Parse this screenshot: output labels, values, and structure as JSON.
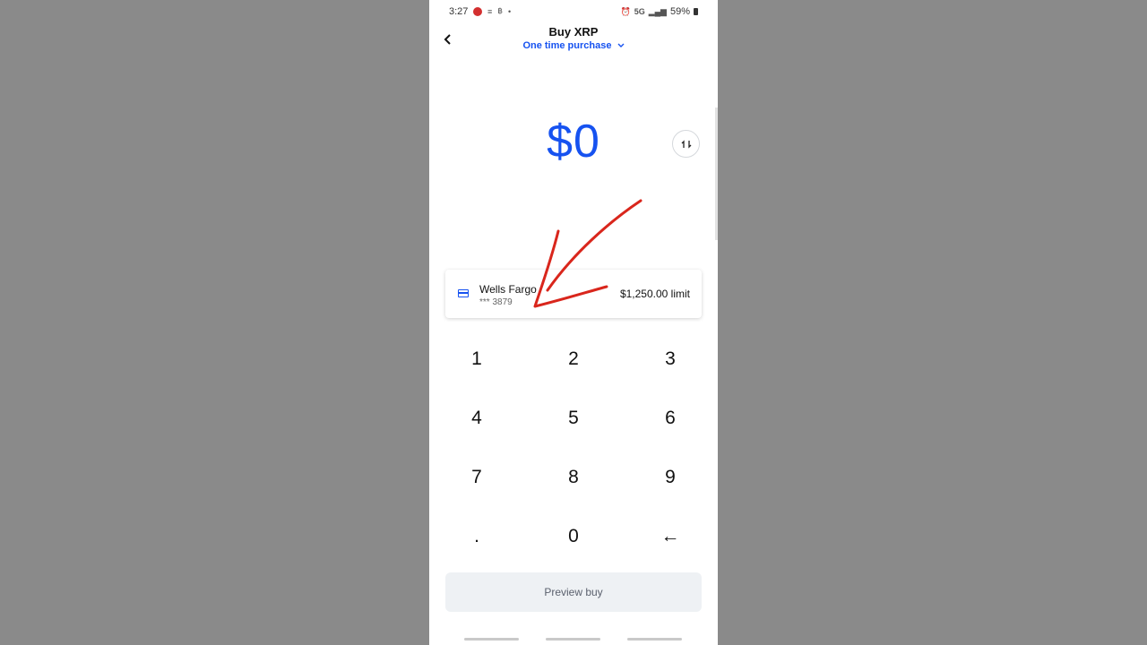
{
  "status_bar": {
    "time": "3:27",
    "network": "5G",
    "battery": "59%"
  },
  "header": {
    "title": "Buy XRP",
    "purchase_type": "One time purchase"
  },
  "amount": {
    "value": "$0"
  },
  "payment_method": {
    "bank_name": "Wells Fargo",
    "account_mask": "*** 3879",
    "limit": "$1,250.00 limit"
  },
  "keypad": {
    "keys": [
      "1",
      "2",
      "3",
      "4",
      "5",
      "6",
      "7",
      "8",
      "9",
      ".",
      "0",
      "←"
    ]
  },
  "preview_button": {
    "label": "Preview buy"
  },
  "colors": {
    "accent": "#1652f0",
    "annotation": "#d9261c"
  },
  "icons": {
    "back": "back-arrow-icon",
    "swap": "swap-icon",
    "card": "bank-card-icon",
    "backspace": "backspace-arrow-icon"
  }
}
